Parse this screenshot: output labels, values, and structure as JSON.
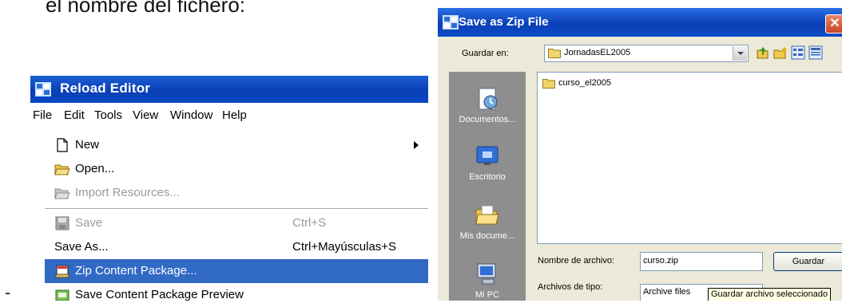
{
  "page": {
    "top_text": "el nombre del fichero:",
    "bullet_dash": "-"
  },
  "reload_editor": {
    "title": "Reload Editor",
    "menubar": [
      "File",
      "Edit",
      "Tools",
      "View",
      "Window",
      "Help"
    ],
    "file_menu": {
      "new": {
        "label": "New",
        "has_submenu": true
      },
      "open": {
        "label": "Open..."
      },
      "import_resources": {
        "label": "Import Resources...",
        "disabled": true
      },
      "save": {
        "label": "Save",
        "shortcut": "Ctrl+S",
        "disabled": true
      },
      "save_as": {
        "label": "Save As...",
        "shortcut": "Ctrl+Mayúsculas+S"
      },
      "zip_content_package": {
        "label": "Zip Content Package...",
        "selected": true
      },
      "save_content_package_preview": {
        "label": "Save Content Package Preview"
      }
    },
    "colors": {
      "title_bar": "#0a3fb5",
      "selection": "#316ac5"
    }
  },
  "save_dialog": {
    "title": "Save as Zip File",
    "close_glyph": "✕",
    "save_in_label": "Guardar en:",
    "save_in_value": "JornadasEL2005",
    "places": [
      {
        "label": "Documentos...",
        "icon": "recent-documents-icon"
      },
      {
        "label": "Escritorio",
        "icon": "desktop-icon"
      },
      {
        "label": "Mis docume...",
        "icon": "my-documents-icon"
      },
      {
        "label": "Mi PC",
        "icon": "my-computer-icon"
      }
    ],
    "files": [
      {
        "name": "curso_el2005",
        "icon": "folder-icon"
      }
    ],
    "filename_label": "Nombre de archivo:",
    "filename_value": "curso.zip",
    "save_button": "Guardar",
    "filetype_label": "Archivos de tipo:",
    "filetype_value": "Archive files",
    "tooltip": "Guardar archivo seleccionado"
  }
}
